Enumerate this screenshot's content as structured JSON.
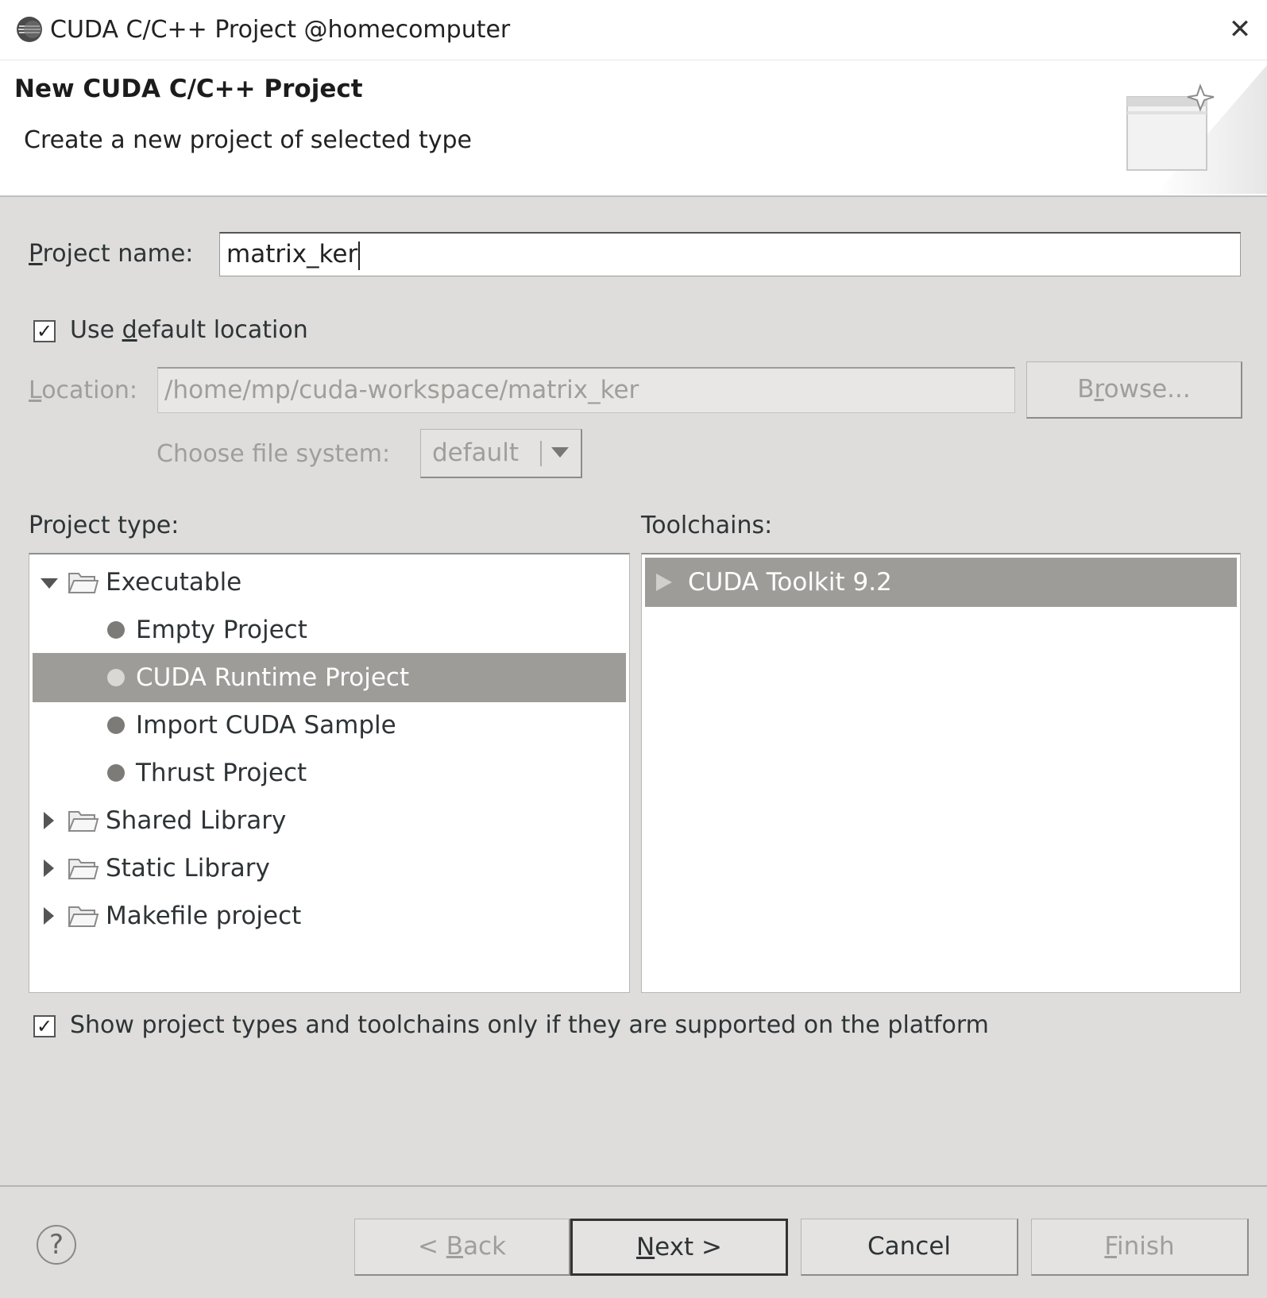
{
  "window": {
    "title": "CUDA C/C++ Project @homecomputer",
    "close_glyph": "✕"
  },
  "banner": {
    "title": "New CUDA C/C++ Project",
    "description": "Create a new project of selected type"
  },
  "form": {
    "project_name_label_mnemonic": "P",
    "project_name_label_rest": "roject name:",
    "project_name_value": "matrix_ker",
    "use_default_location_checked": true,
    "use_default_pre": "Use ",
    "use_default_mnemonic": "d",
    "use_default_post": "efault location",
    "location_label_mnemonic": "L",
    "location_label_rest": "ocation:",
    "location_value": "/home/mp/cuda-workspace/matrix_ker",
    "browse_pre": "B",
    "browse_mnemonic": "r",
    "browse_post": "owse...",
    "file_system_label": "Choose file system:",
    "file_system_value": "default"
  },
  "project_type": {
    "label": "Project type:",
    "items": [
      {
        "label": "Executable",
        "kind": "folder",
        "expanded": true
      },
      {
        "label": "Empty Project",
        "kind": "leaf"
      },
      {
        "label": "CUDA Runtime Project",
        "kind": "leaf",
        "selected": true
      },
      {
        "label": "Import CUDA Sample",
        "kind": "leaf"
      },
      {
        "label": "Thrust Project",
        "kind": "leaf"
      },
      {
        "label": "Shared Library",
        "kind": "folder",
        "expanded": false
      },
      {
        "label": "Static Library",
        "kind": "folder",
        "expanded": false
      },
      {
        "label": "Makefile project",
        "kind": "folder",
        "expanded": false
      }
    ]
  },
  "toolchains": {
    "label": "Toolchains:",
    "items": [
      {
        "label": "CUDA Toolkit 9.2",
        "selected": true
      }
    ]
  },
  "show_supported": {
    "checked": true,
    "label": "Show project types and toolchains only if they are supported on the platform"
  },
  "buttons": {
    "help": "?",
    "back_pre": "< ",
    "back_mnemonic": "B",
    "back_post": "ack",
    "next_mnemonic": "N",
    "next_post": "ext >",
    "cancel": "Cancel",
    "finish_mnemonic": "F",
    "finish_post": "inish"
  },
  "check_glyph": "✓"
}
